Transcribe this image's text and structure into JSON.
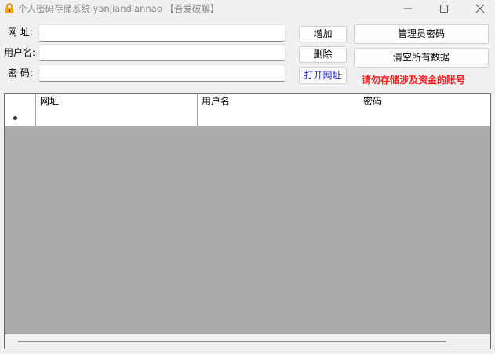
{
  "window": {
    "title": "个人密码存储系统 yanjiandiannao 【吾爱破解】",
    "icon": "padlock-icon"
  },
  "form": {
    "url_label": "网 址:",
    "username_label": "用户名:",
    "password_label": "密 码:",
    "url_value": "",
    "username_value": "",
    "password_value": ""
  },
  "buttons": {
    "add": "增加",
    "delete": "删除",
    "open_url": "打开网址",
    "admin_password": "管理员密码",
    "clear_all": "清空所有数据"
  },
  "warning": "请勿存储涉及资金的账号",
  "table": {
    "columns": [
      "网址",
      "用户名",
      "密码"
    ],
    "rows": [
      {
        "url": "",
        "username": "",
        "password": ""
      }
    ]
  },
  "colors": {
    "warning": "#ff1a1a",
    "link_button": "#1a22c8",
    "grid_background": "#ababab"
  }
}
